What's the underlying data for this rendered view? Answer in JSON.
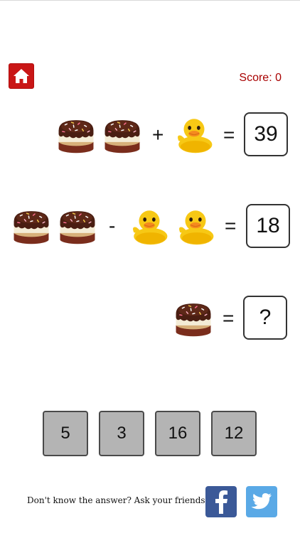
{
  "header": {
    "score_label": "Score: 0"
  },
  "puzzle": {
    "equations": [
      {
        "items": [
          "donut-icon",
          "donut-icon",
          "plus",
          "duck-icon"
        ],
        "operator_symbol": "+",
        "equals": "=",
        "result": "39"
      },
      {
        "items": [
          "donut-icon",
          "donut-icon",
          "minus",
          "duck-icon",
          "duck-icon"
        ],
        "operator_symbol": "-",
        "equals": "=",
        "result": "18"
      },
      {
        "items": [
          "donut-icon"
        ],
        "equals": "=",
        "result": "?"
      }
    ]
  },
  "answers": [
    "5",
    "3",
    "16",
    "12"
  ],
  "footer": {
    "ask_text": "Don't know the answer? Ask your friends",
    "social": [
      "facebook-icon",
      "twitter-icon"
    ]
  },
  "colors": {
    "home_button": "#c91616",
    "score_text": "#a80000",
    "answer_button": "#b4b4b4",
    "facebook": "#3b5998",
    "twitter": "#5aa9e6"
  }
}
